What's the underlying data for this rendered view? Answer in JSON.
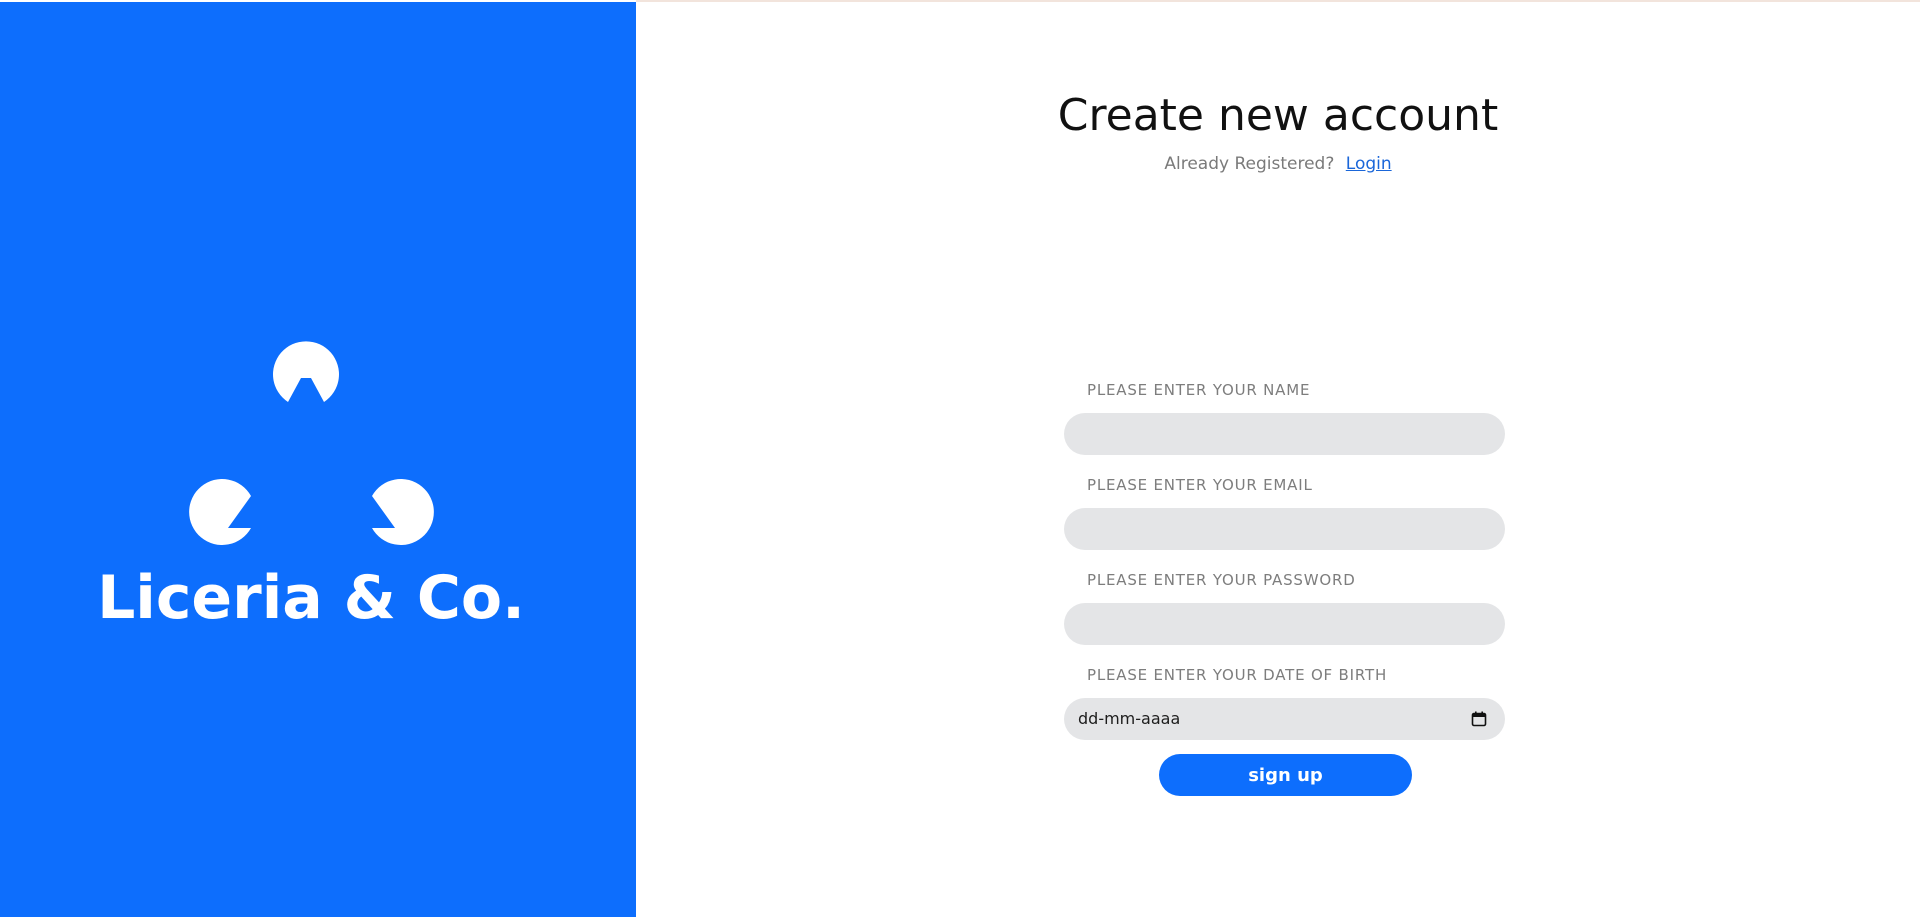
{
  "brand": {
    "name": "Liceria & Co.",
    "color": "#0d6efd"
  },
  "header": {
    "title": "Create new account",
    "subtitle": "Already Registered?",
    "login_link": "Login"
  },
  "form": {
    "name_label": "PLEASE ENTER YOUR NAME",
    "name_value": "",
    "email_label": "PLEASE ENTER YOUR EMAIL",
    "email_value": "",
    "password_label": "PLEASE ENTER YOUR PASSWORD",
    "password_value": "",
    "dob_label": "PLEASE ENTER YOUR DATE OF BIRTH",
    "dob_placeholder": "dd-mm-aaaa",
    "submit_label": "sign up"
  },
  "icons": {
    "calendar": "calendar-icon",
    "logo": "liceria-logo-icon"
  }
}
